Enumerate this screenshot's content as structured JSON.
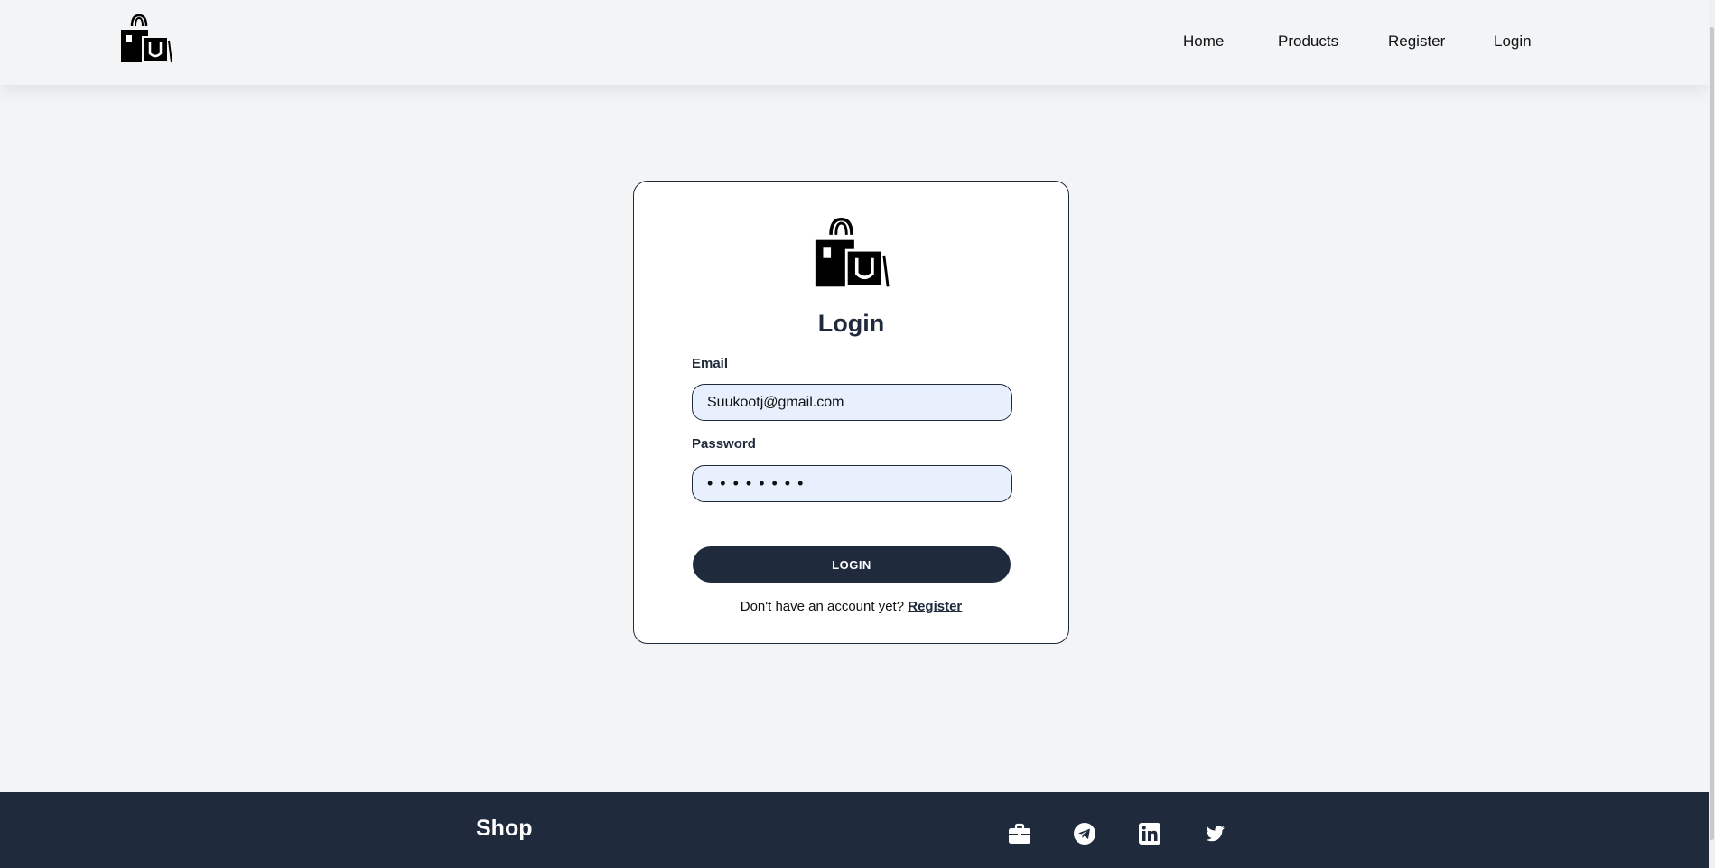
{
  "header": {
    "logo_icon": "shopping-bags-icon",
    "nav": [
      "Home",
      "Products",
      "Register",
      "Login"
    ]
  },
  "login_card": {
    "logo_icon": "shopping-bags-icon",
    "title": "Login",
    "email_label": "Email",
    "email_value": "Suukootj@gmail.com",
    "password_label": "Password",
    "password_value": "••••••••",
    "button_label": "LOGIN",
    "register_prompt": "Don't have an account yet?",
    "register_link": "Register"
  },
  "footer": {
    "brand": "Shop",
    "icons": [
      "briefcase-icon",
      "telegram-icon",
      "linkedin-icon",
      "twitter-icon"
    ]
  },
  "colors": {
    "navy": "#1f2a3c",
    "background": "#f3f4f6",
    "input_fill": "#e8f0fe"
  }
}
